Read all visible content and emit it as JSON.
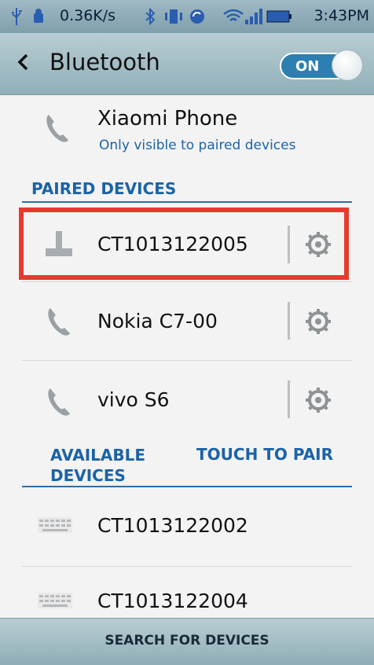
{
  "status_bar": {
    "speed": "0.36K/s",
    "time": "3:43PM",
    "icons": [
      "usb-icon",
      "android-icon",
      "bluetooth-icon",
      "vibrate-icon",
      "sync-icon",
      "wifi-icon",
      "signal-icon",
      "battery-icon"
    ]
  },
  "header": {
    "title": "Bluetooth",
    "toggle_label": "ON"
  },
  "this_device": {
    "name": "Xiaomi Phone",
    "visibility": "Only visible to paired devices"
  },
  "paired": {
    "section_title": "PAIRED DEVICES",
    "devices": [
      {
        "name": "CT1013122005",
        "icon": "computer-icon"
      },
      {
        "name": "Nokia C7-00",
        "icon": "phone-icon"
      },
      {
        "name": "vivo S6",
        "icon": "phone-icon"
      }
    ]
  },
  "available": {
    "section_title": "AVAILABLE DEVICES",
    "action_label": "TOUCH TO PAIR",
    "devices": [
      {
        "name": "CT1013122002",
        "icon": "keyboard-icon"
      },
      {
        "name": "CT1013122004",
        "icon": "keyboard-icon"
      }
    ]
  },
  "footer": {
    "search_label": "SEARCH FOR DEVICES"
  },
  "colors": {
    "accent": "#1b63a6",
    "highlight": "#e53a2e",
    "toggle_on": "#2c7fb0"
  }
}
